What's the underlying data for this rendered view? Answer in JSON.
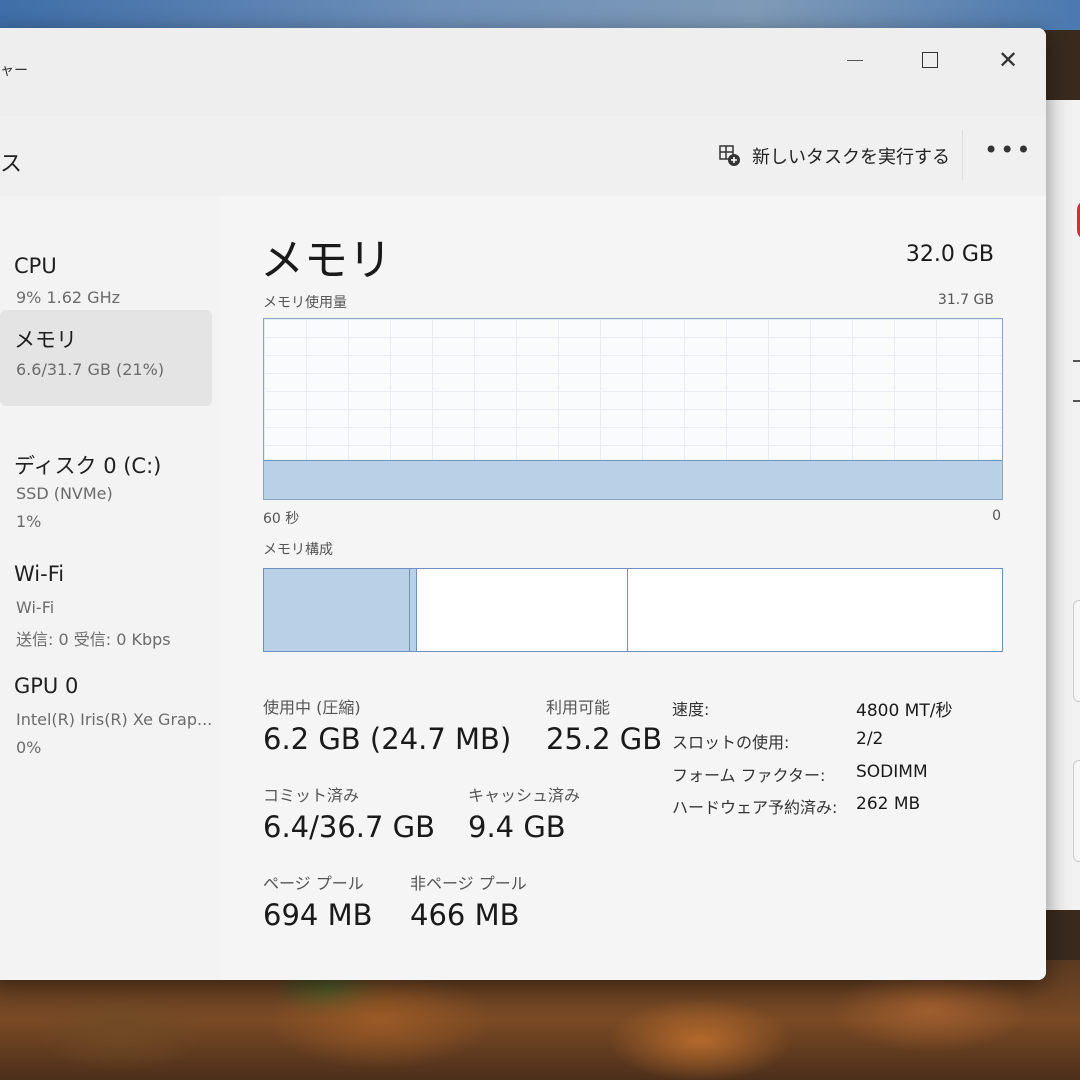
{
  "window": {
    "title": "ャー",
    "header_title": "ス",
    "new_task_label": "新しいタスクを実行する",
    "more_label": "•••"
  },
  "sidebar": {
    "items": [
      {
        "name": "CPU",
        "sub1": "9%  1.62 GHz",
        "sub2": ""
      },
      {
        "name": "メモリ",
        "sub1": "6.6/31.7 GB (21%)",
        "sub2": ""
      },
      {
        "name": "ディスク 0 (C:)",
        "sub1": "SSD (NVMe)",
        "sub2": "1%"
      },
      {
        "name": "Wi-Fi",
        "sub1": "Wi-Fi",
        "sub2": "送信: 0  受信: 0 Kbps"
      },
      {
        "name": "GPU 0",
        "sub1": "Intel(R) Iris(R) Xe Grap...",
        "sub2": "0%"
      }
    ],
    "active_index": 1
  },
  "memory": {
    "title": "メモリ",
    "total": "32.0 GB",
    "usage_label": "メモリ使用量",
    "usage_max": "31.7 GB",
    "usage_fraction": 0.21,
    "axis_left": "60 秒",
    "axis_right": "0",
    "composition_label": "メモリ構成",
    "composition": [
      {
        "name": "in-use",
        "fraction": 0.198,
        "color": "#b9d1e6"
      },
      {
        "name": "modified",
        "fraction": 0.01,
        "color": "#b9d1e6"
      },
      {
        "name": "standby",
        "fraction": 0.285,
        "color": "#ffffff"
      },
      {
        "name": "free",
        "fraction": 0.507,
        "color": "#ffffff"
      }
    ],
    "stats": {
      "in_use_label": "使用中 (圧縮)",
      "in_use_value": "6.2 GB (24.7 MB)",
      "available_label": "利用可能",
      "available_value": "25.2 GB",
      "committed_label": "コミット済み",
      "committed_value": "6.4/36.7 GB",
      "cached_label": "キャッシュ済み",
      "cached_value": "9.4 GB",
      "paged_label": "ページ プール",
      "paged_value": "694 MB",
      "nonpaged_label": "非ページ プール",
      "nonpaged_value": "466 MB"
    },
    "specs": [
      {
        "key": "速度:",
        "value": "4800 MT/秒"
      },
      {
        "key": "スロットの使用:",
        "value": "2/2"
      },
      {
        "key": "フォーム ファクター:",
        "value": "SODIMM"
      },
      {
        "key": "ハードウェア予約済み:",
        "value": "262 MB"
      }
    ]
  }
}
